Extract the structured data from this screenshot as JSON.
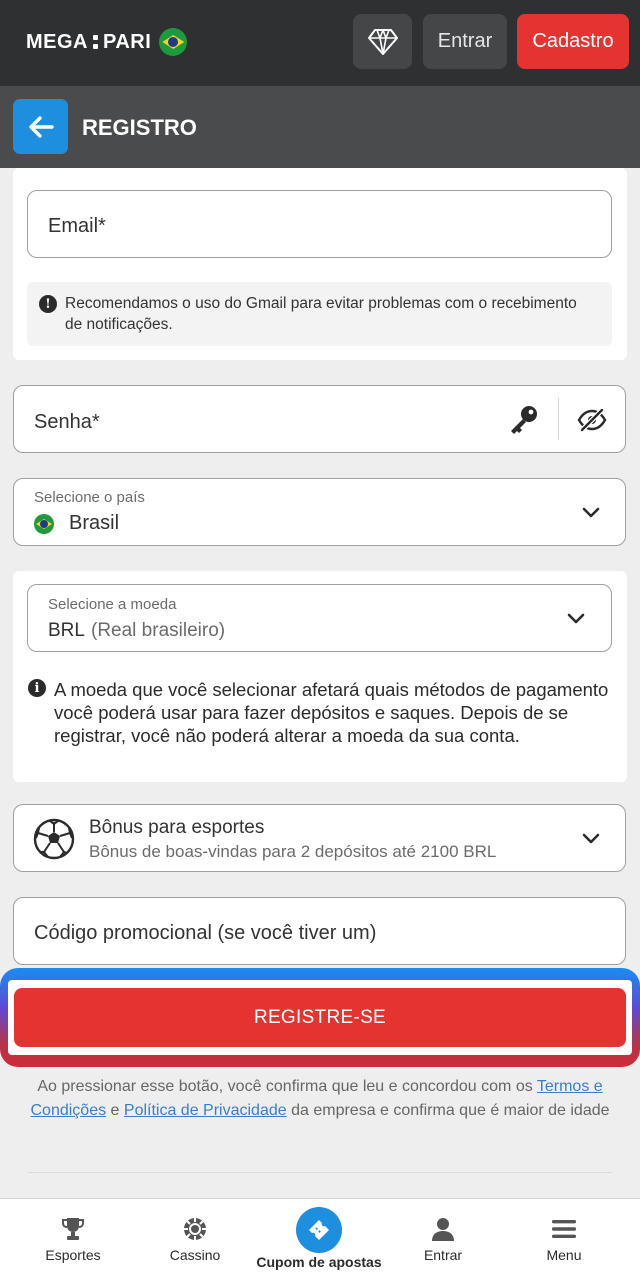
{
  "header": {
    "logo_left": "MEGA",
    "logo_right": "PARI",
    "login_label": "Entrar",
    "signup_label": "Cadastro",
    "diamond_icon": "diamond-icon"
  },
  "subheader": {
    "title": "REGISTRO",
    "back_icon": "arrow-left-icon"
  },
  "form": {
    "email_placeholder": "Email*",
    "gmail_note": "Recomendamos o uso do Gmail para evitar problemas com o recebimento de notificações.",
    "password_placeholder": "Senha*",
    "country_label": "Selecione o país",
    "country_value": "Brasil",
    "currency_label": "Selecione a moeda",
    "currency_code": "BRL",
    "currency_name": "(Real brasileiro)",
    "currency_note": "A moeda que você selecionar afetará quais métodos de pagamento você poderá usar para fazer depósitos e saques. Depois de se registrar, você não poderá alterar a moeda da sua conta.",
    "bonus_title": "Bônus para esportes",
    "bonus_subtitle": "Bônus de boas-vindas para 2 depósitos até 2100 BRL",
    "promo_placeholder": "Código promocional (se você tiver um)",
    "register_label": "REGISTRE-SE"
  },
  "terms": {
    "prefix": "Ao pressionar esse botão, você confirma que leu e concordou com os ",
    "terms_link": "Termos e Condições",
    "and": " e ",
    "privacy_link": "Política de Privacidade",
    "suffix": " da empresa e confirma que é maior de idade"
  },
  "bottom_nav": {
    "items": [
      {
        "label": "Esportes",
        "icon": "trophy-icon"
      },
      {
        "label": "Cassino",
        "icon": "casino-chip-icon"
      },
      {
        "label": "Cupom de apostas",
        "icon": "ticket-icon"
      },
      {
        "label": "Entrar",
        "icon": "user-icon"
      },
      {
        "label": "Menu",
        "icon": "hamburger-icon"
      }
    ]
  },
  "colors": {
    "topbar": "#2f3031",
    "subheader": "#4a4b4c",
    "accent_red": "#e53430",
    "accent_blue": "#1e8fde",
    "link": "#3a7ec8"
  }
}
